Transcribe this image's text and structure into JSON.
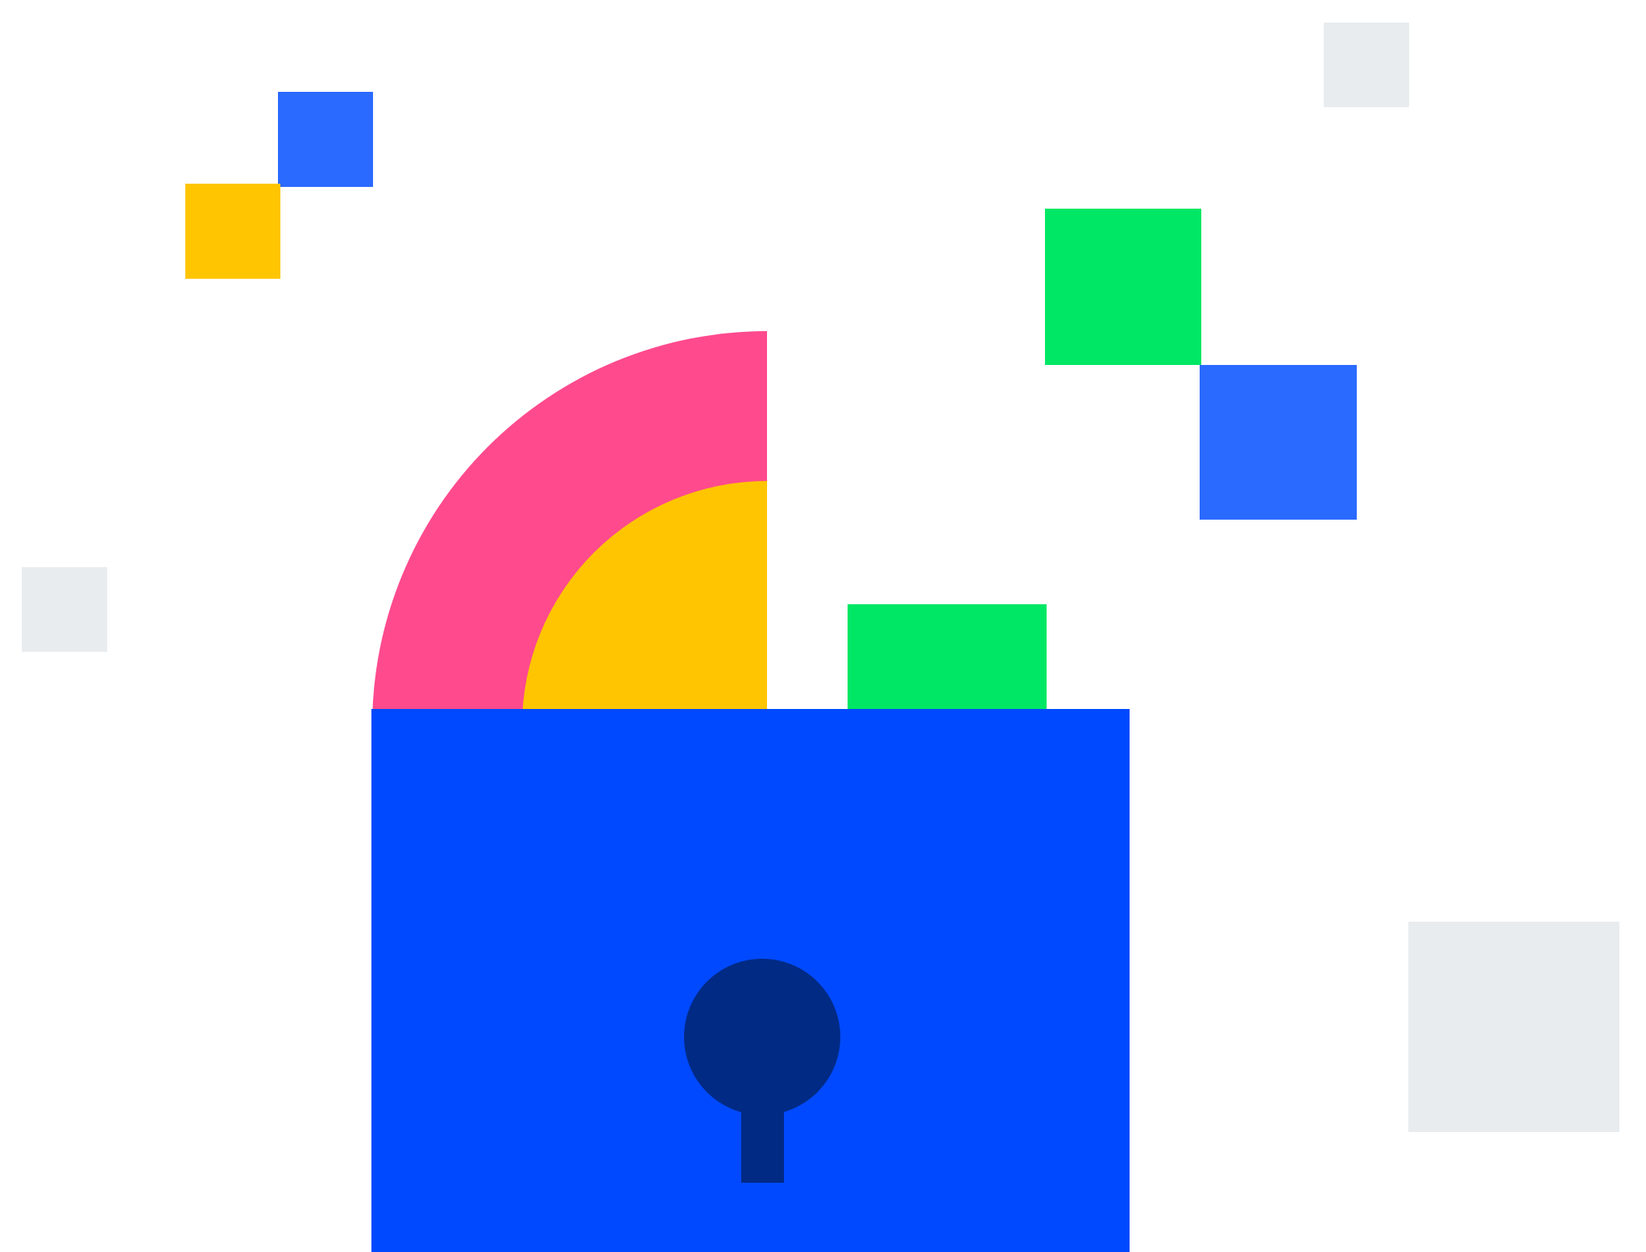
{
  "illustration": {
    "subject": "unlocked-padlock",
    "colors": {
      "background": "#ffffff",
      "lock_body": "#0049ff",
      "keyhole": "#002a84",
      "shackle_outer": "#ff4a8e",
      "shackle_inner": "#ffc500",
      "accent_green": "#00e765",
      "accent_blue": "#2a6aff",
      "accent_yellow": "#ffc500",
      "accent_gray": "#e8ecef"
    }
  }
}
